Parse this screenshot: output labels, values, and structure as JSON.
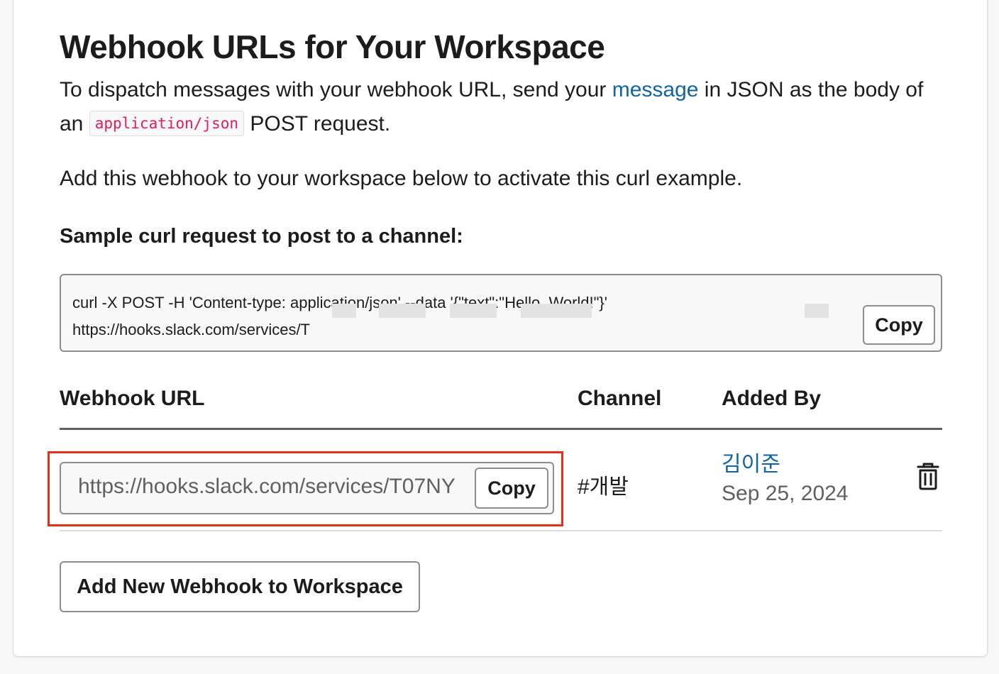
{
  "title": "Webhook URLs for Your Workspace",
  "intro": {
    "part1": "To dispatch messages with your webhook URL, send your ",
    "link": "message",
    "part2": " in JSON as the body of an ",
    "code": "application/json",
    "part3": " POST request."
  },
  "activate_note": "Add this webhook to your workspace below to activate this curl example.",
  "sample_label": "Sample curl request to post to a channel:",
  "curl": {
    "line1": "curl -X POST -H 'Content-type: application/json' --data '{\"text\":\"Hello, World!\"}'",
    "line2": "https://hooks.slack.com/services/T",
    "copy_label": "Copy"
  },
  "table": {
    "col_url": "Webhook URL",
    "col_channel": "Channel",
    "col_added_by": "Added By",
    "rows": [
      {
        "url": "https://hooks.slack.com/services/T07NY",
        "copy_label": "Copy",
        "channel": "#개발",
        "added_by": "김이준",
        "date": "Sep 25, 2024"
      }
    ]
  },
  "add_button": "Add New Webhook to Workspace",
  "colors": {
    "link": "#1264a3",
    "code": "#e01e5a",
    "highlight": "#e0331b",
    "text": "#1d1c1d",
    "muted": "#616061"
  },
  "icons": {
    "delete": "trash-icon"
  }
}
